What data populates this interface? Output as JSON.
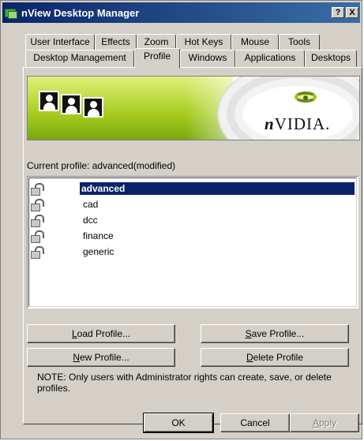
{
  "window": {
    "title": "nView Desktop Manager",
    "help": "?",
    "close": "X"
  },
  "tabs": {
    "row1": [
      {
        "label": "User Interface"
      },
      {
        "label": "Effects"
      },
      {
        "label": "Zoom"
      },
      {
        "label": "Hot Keys"
      },
      {
        "label": "Mouse"
      },
      {
        "label": "Tools"
      }
    ],
    "row2": [
      {
        "label": "Desktop Management"
      },
      {
        "label": "Profile",
        "active": true
      },
      {
        "label": "Windows"
      },
      {
        "label": "Applications"
      },
      {
        "label": "Desktops"
      }
    ]
  },
  "banner": {
    "brand": "nVIDIA.",
    "brand_lead": "n",
    "brand_rest": "VIDIA."
  },
  "profile": {
    "current_label": "Current profile:",
    "current_value": "advanced(modified)",
    "items": [
      {
        "name": "advanced",
        "selected": true
      },
      {
        "name": "cad"
      },
      {
        "name": "dcc"
      },
      {
        "name": "finance"
      },
      {
        "name": "generic"
      }
    ]
  },
  "buttons": {
    "load": {
      "u": "L",
      "rest": "oad Profile..."
    },
    "save": {
      "u": "S",
      "rest": "ave Profile..."
    },
    "new": {
      "u": "N",
      "rest": "ew Profile..."
    },
    "delete": {
      "u": "D",
      "rest": "elete Profile"
    },
    "ok": "OK",
    "cancel": "Cancel",
    "apply": {
      "u": "A",
      "rest": "pply"
    }
  },
  "note": "NOTE: Only users with Administrator rights can create, save, or delete profiles.",
  "colors": {
    "selection": "#0a246a",
    "titlebar": "#0a246a",
    "face": "#d4d0c8",
    "nvidia_green": "#76b900"
  }
}
